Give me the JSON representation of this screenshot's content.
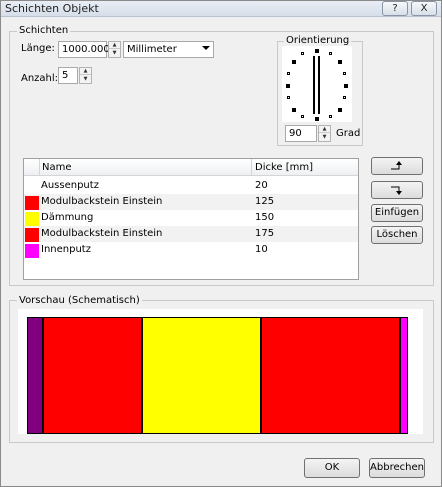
{
  "window": {
    "title": "Schichten Objekt"
  },
  "titlebar_buttons": {
    "help": "?",
    "close": "X"
  },
  "schichten": {
    "group_label": "Schichten",
    "laenge_label": "Länge:",
    "laenge_value": "1000.000",
    "unit_value": "Millimeter",
    "anzahl_label": "Anzahl:",
    "anzahl_value": "5"
  },
  "orientierung": {
    "label": "Orientierung",
    "value": "90",
    "unit": "Grad"
  },
  "table": {
    "columns": [
      "Name",
      "Dicke [mm]"
    ],
    "rows": [
      {
        "name": "Aussenputz",
        "dicke": "20",
        "color": ""
      },
      {
        "name": "Modulbackstein Einstein",
        "dicke": "125",
        "color": "#ff0000"
      },
      {
        "name": "Dämmung",
        "dicke": "150",
        "color": "#ffff00"
      },
      {
        "name": "Modulbackstein Einstein",
        "dicke": "175",
        "color": "#ff0000"
      },
      {
        "name": "Innenputz",
        "dicke": "10",
        "color": "#ff00ff"
      }
    ]
  },
  "buttons": {
    "einfuegen": "Einfügen",
    "loeschen": "Löschen",
    "ok": "OK",
    "abbrechen": "Abbrechen"
  },
  "preview": {
    "label": "Vorschau (Schematisch)",
    "layers": [
      {
        "color": "#800080",
        "thickness": 20
      },
      {
        "color": "#ff0000",
        "thickness": 125
      },
      {
        "color": "#ffff00",
        "thickness": 150
      },
      {
        "color": "#ff0000",
        "thickness": 175
      },
      {
        "color": "#ff00ff",
        "thickness": 10
      }
    ]
  }
}
